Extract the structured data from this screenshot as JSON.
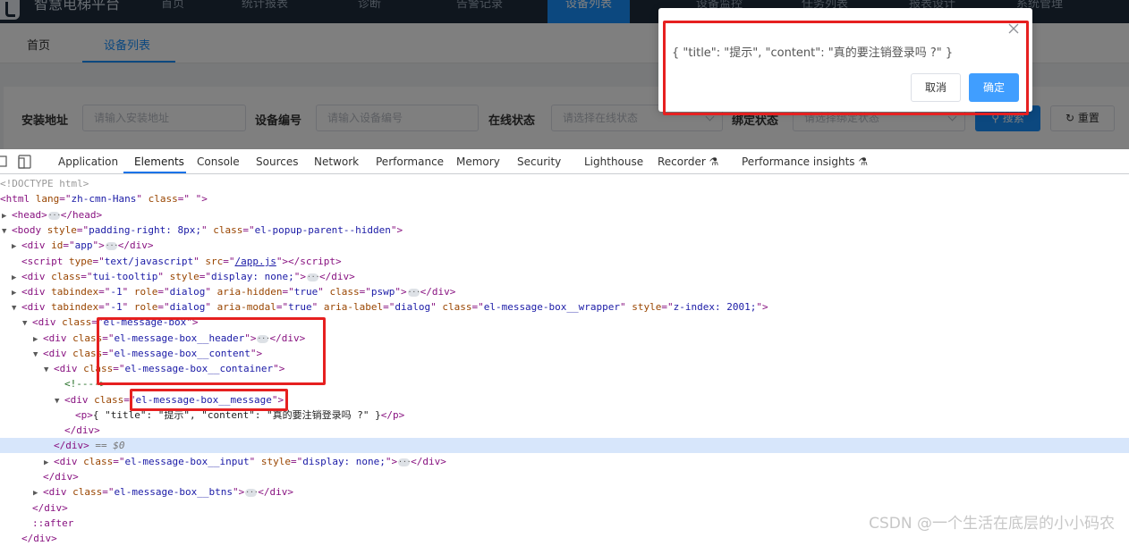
{
  "app": {
    "title": "智慧电梯平台"
  },
  "nav": {
    "items": [
      "首页",
      "统计报表",
      "诊断",
      "告警记录",
      "设备列表",
      "设备监控",
      "任务列表",
      "报表设计",
      "系统管理"
    ]
  },
  "tabs": [
    "首页",
    "设备列表"
  ],
  "search_form": {
    "address_label": "安装地址",
    "address_placeholder": "请输入安装地址",
    "device_no_label": "设备编号",
    "device_no_placeholder": "请输入设备编号",
    "online_label": "在线状态",
    "online_placeholder": "请选择在线状态",
    "bind_label": "绑定状态",
    "bind_placeholder": "请选择绑定状态",
    "search_button": "搜索",
    "reset_button": "重置"
  },
  "message_box": {
    "message": "{ \"title\": \"提示\", \"content\": \"真的要注销登录吗 ?\" }",
    "cancel": "取消",
    "confirm": "确定"
  },
  "devtools": {
    "tabs": [
      "Application",
      "Elements",
      "Console",
      "Sources",
      "Network",
      "Performance",
      "Memory",
      "Security",
      "Lighthouse",
      "Recorder",
      "Performance insights"
    ],
    "active_tab": "Elements",
    "lines": {
      "doctype": "<!DOCTYPE html>",
      "html_attr_lang": "zh-cmn-Hans",
      "html_attr_class": " ",
      "body_style": "padding-right: 8px;",
      "body_class": "el-popup-parent--hidden",
      "app_id": "app",
      "script_type": "text/javascript",
      "script_src": "/app.js",
      "tooltip_class": "tui-tooltip",
      "tooltip_style": "display: none;",
      "pswp_tabindex": "-1",
      "pswp_role": "dialog",
      "pswp_hidden": "true",
      "pswp_class": "pswp",
      "wrap_tabindex": "-1",
      "wrap_role": "dialog",
      "wrap_modal": "true",
      "wrap_label": "dialog",
      "wrap_class": "el-message-box__wrapper",
      "wrap_style": "z-index: 2001;",
      "msgbox_class": "el-message-box",
      "header_class": "el-message-box__header",
      "content_class": "el-message-box__content",
      "container_class": "el-message-box__container",
      "comment": "<!---->",
      "message_class": "el-message-box__message",
      "p_text": "{ \"title\": \"提示\", \"content\": \"真的要注销登录吗 ?\" }",
      "selected_marker": "== $0",
      "input_class": "el-message-box__input",
      "input_style": "display: none;",
      "btns_class": "el-message-box__btns",
      "after": "::after"
    }
  },
  "watermark": "CSDN @一个生活在底层的小小码农"
}
